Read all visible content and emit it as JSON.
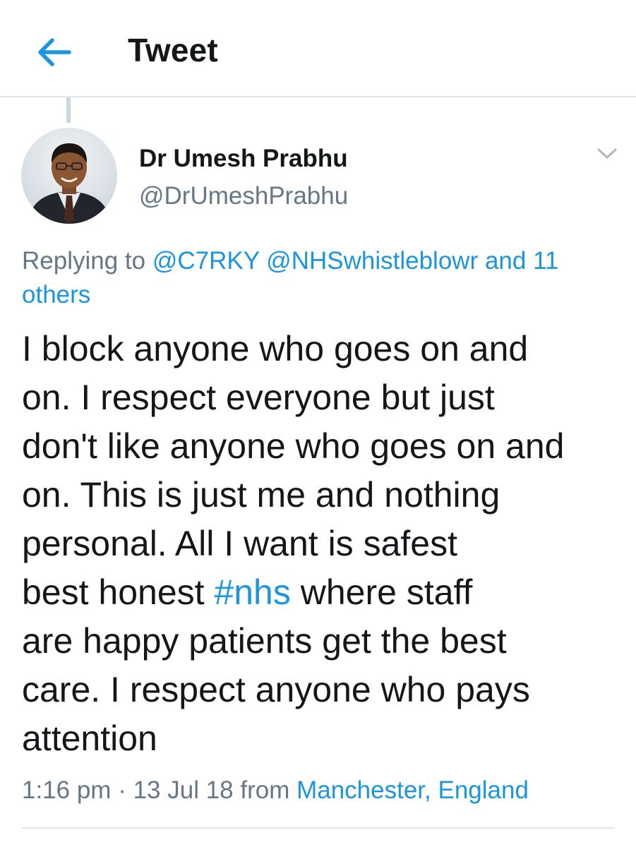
{
  "header": {
    "title": "Tweet",
    "back_icon": "arrow-left-icon"
  },
  "author": {
    "display_name": "Dr Umesh Prabhu",
    "handle": "@DrUmeshPrabhu",
    "avatar_icon": "user-avatar",
    "menu_icon": "chevron-down-icon"
  },
  "reply": {
    "prefix": "Replying to ",
    "mention_1": "@C7RKY",
    "mention_2": "@NHSwhistleblowr",
    "others": "and 11 others"
  },
  "tweet": {
    "line_1": "I block anyone who goes on and",
    "line_2": "on. I respect everyone but just",
    "line_3": "don't like anyone who goes on and",
    "line_4": "on. This is just me and nothing",
    "line_5": "personal. All I want is safest",
    "line_6_pre": "best honest ",
    "hashtag": "#nhs",
    "line_6_post": " where staff",
    "line_7": "are happy patients get the best",
    "line_8": "care. I respect anyone who pays",
    "line_9": "attention"
  },
  "meta": {
    "time": "1:16 pm",
    "separator": " · ",
    "date": "13 Jul 18",
    "from_label": " from ",
    "location": "Manchester, England"
  },
  "colors": {
    "accent": "#1b95e0",
    "text": "#14171a",
    "secondary": "#657786",
    "divider": "#e1e8ed"
  }
}
